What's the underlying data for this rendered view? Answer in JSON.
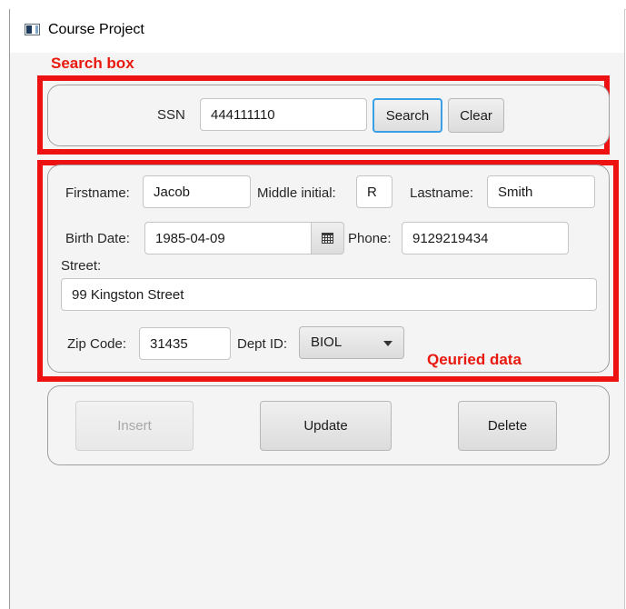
{
  "window": {
    "title": "Course Project"
  },
  "annotations": {
    "search_box": "Search box",
    "queried_data": "Qeuried data"
  },
  "search": {
    "ssn_label": "SSN",
    "ssn_value": "444111110",
    "search_label": "Search",
    "clear_label": "Clear"
  },
  "form": {
    "firstname_label": "Firstname:",
    "firstname_value": "Jacob",
    "middle_label": "Middle initial:",
    "middle_value": "R",
    "lastname_label": "Lastname:",
    "lastname_value": "Smith",
    "birth_label": "Birth Date:",
    "birth_value": "1985-04-09",
    "phone_label": "Phone:",
    "phone_value": "9129219434",
    "street_label": "Street:",
    "street_value": "99 Kingston Street",
    "zip_label": "Zip Code:",
    "zip_value": "31435",
    "dept_label": "Dept ID:",
    "dept_value": "BIOL"
  },
  "actions": {
    "insert_label": "Insert",
    "update_label": "Update",
    "delete_label": "Delete"
  },
  "icons": {
    "app": "app-icon",
    "calendar": "calendar-icon",
    "dropdown": "chevron-down-icon"
  },
  "colors": {
    "annotation": "#ee1111",
    "focus": "#39a0e8"
  }
}
